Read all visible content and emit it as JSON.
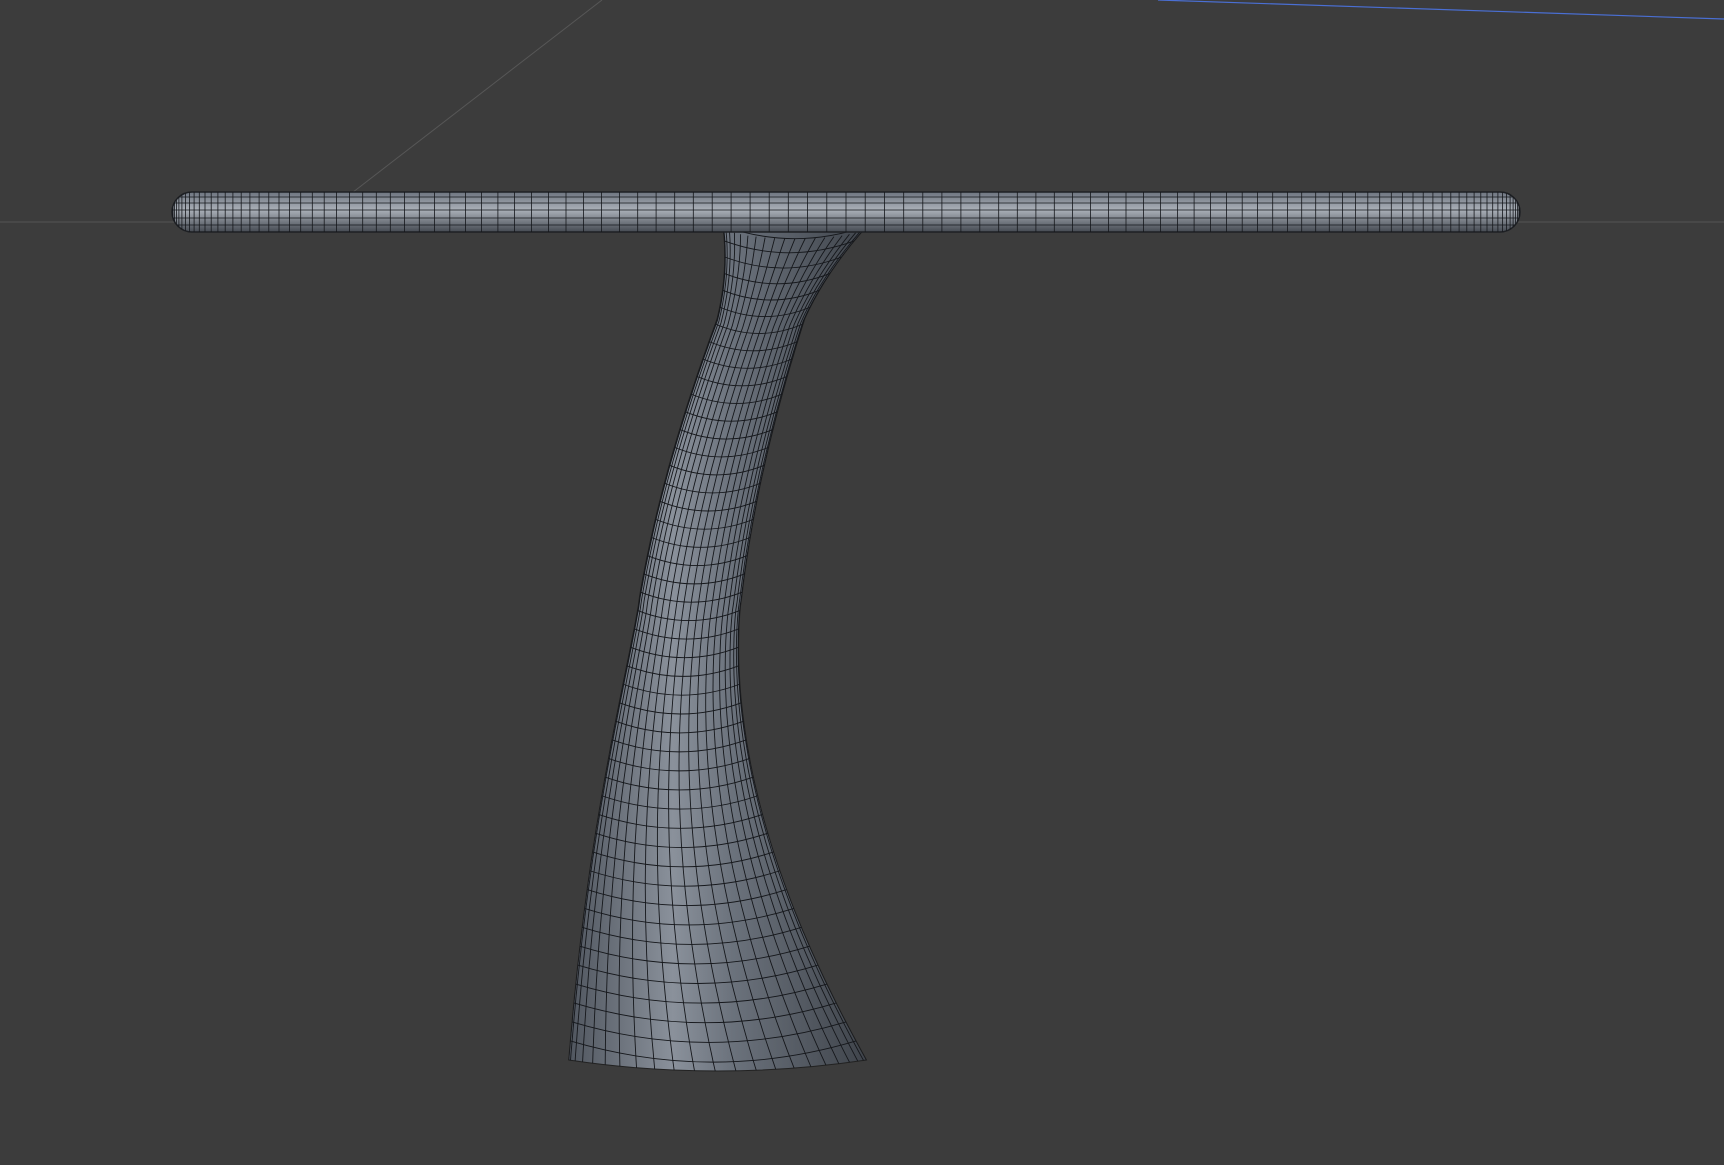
{
  "viewport": {
    "background_color": "#3c3c3c",
    "grid_line_color": "#5a5a5a",
    "axis_line_color": "#4a6fd4",
    "object": {
      "name_icon": "pedestal-table-mesh",
      "surface_color": "#5d6470",
      "surface_highlight": "#9aa1ab",
      "wire_color": "#15171b",
      "display_mode": "shaded-with-wireframe"
    }
  }
}
